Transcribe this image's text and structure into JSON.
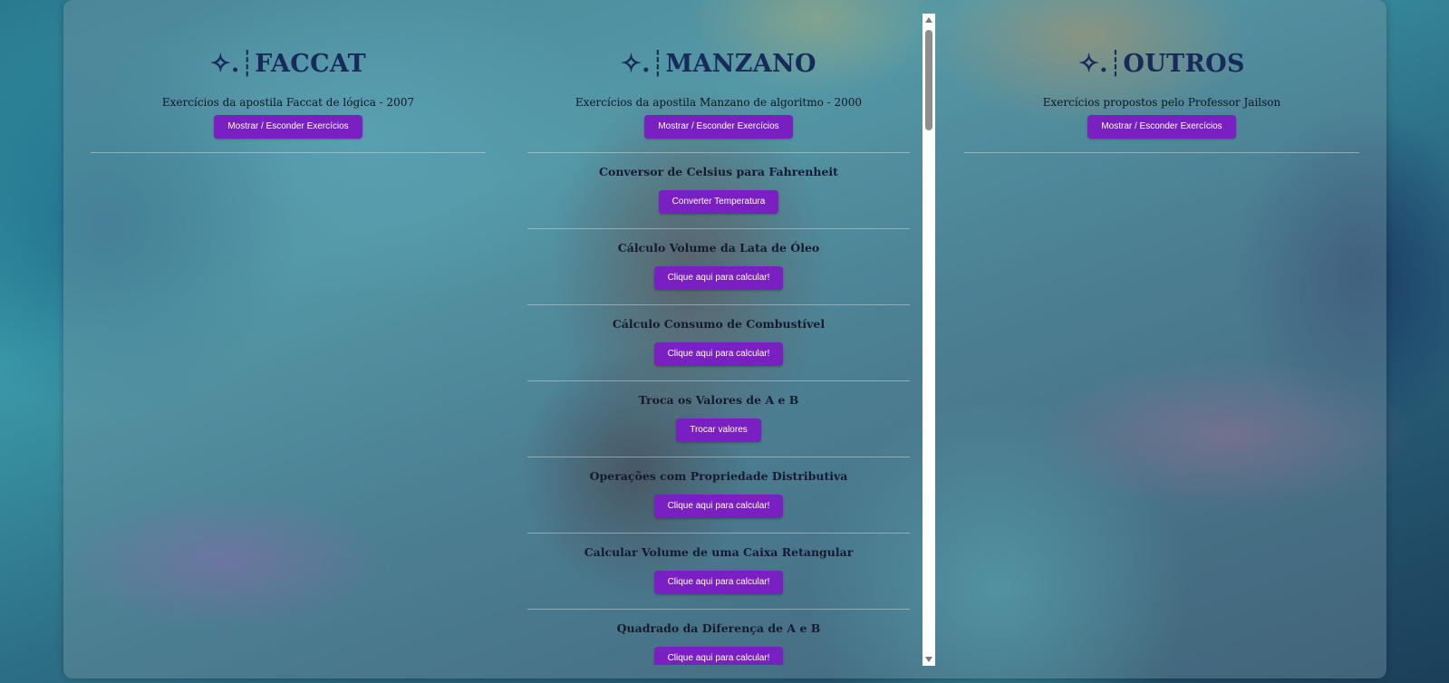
{
  "columns": {
    "faccat": {
      "title": "✧.┊FACCAT",
      "description": "Exercícios da apostila Faccat de lógica - 2007",
      "toggle_label": "Mostrar / Esconder Exercícios"
    },
    "manzano": {
      "title": "✧.┊MANZANO",
      "description": "Exercícios da apostila Manzano de algoritmo - 2000",
      "toggle_label": "Mostrar / Esconder Exercícios",
      "exercises": [
        {
          "title": "Conversor de Celsius para Fahrenheit",
          "button": "Converter Temperatura"
        },
        {
          "title": "Cálculo Volume da Lata de Óleo",
          "button": "Clique aqui para calcular!"
        },
        {
          "title": "Cálculo Consumo de Combustível",
          "button": "Clique aqui para calcular!"
        },
        {
          "title": "Troca os Valores de A e B",
          "button": "Trocar valores"
        },
        {
          "title": "Operações com Propriedade Distributiva",
          "button": "Clique aqui para calcular!"
        },
        {
          "title": "Calcular Volume de uma Caixa Retangular",
          "button": "Clique aqui para calcular!"
        },
        {
          "title": "Quadrado da Diferença de A e B",
          "button": "Clique aqui para calcular!"
        }
      ]
    },
    "outros": {
      "title": "✧.┊OUTROS",
      "description": "Exercícios propostos pelo Professor Jailson",
      "toggle_label": "Mostrar / Esconder Exercícios"
    }
  },
  "colors": {
    "button": "#7a1fc2",
    "title": "#182a5a"
  }
}
